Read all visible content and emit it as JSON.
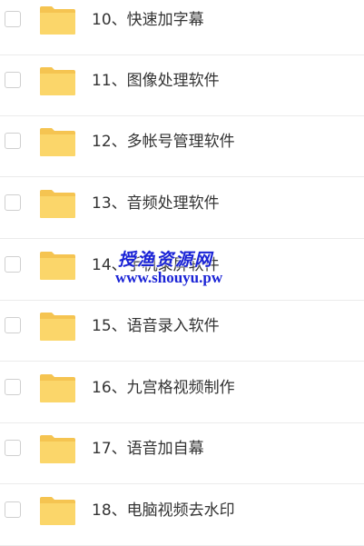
{
  "items": [
    {
      "label": "10、快速加字幕"
    },
    {
      "label": "11、图像处理软件"
    },
    {
      "label": "12、多帐号管理软件"
    },
    {
      "label": "13、音频处理软件"
    },
    {
      "label": "14、手机录屏软件"
    },
    {
      "label": "15、语音录入软件"
    },
    {
      "label": "16、九宫格视频制作"
    },
    {
      "label": "17、语音加自幕"
    },
    {
      "label": "18、电脑视频去水印"
    }
  ],
  "icons": {
    "folder": "folder-icon",
    "checkbox": "checkbox-icon"
  },
  "colors": {
    "folder_body": "#fbd66a",
    "folder_back": "#f5c451",
    "text": "#333333",
    "watermark": "#1a23d6"
  },
  "watermark": {
    "title": "授渔资源网",
    "url": "www.shouyu.pw"
  }
}
